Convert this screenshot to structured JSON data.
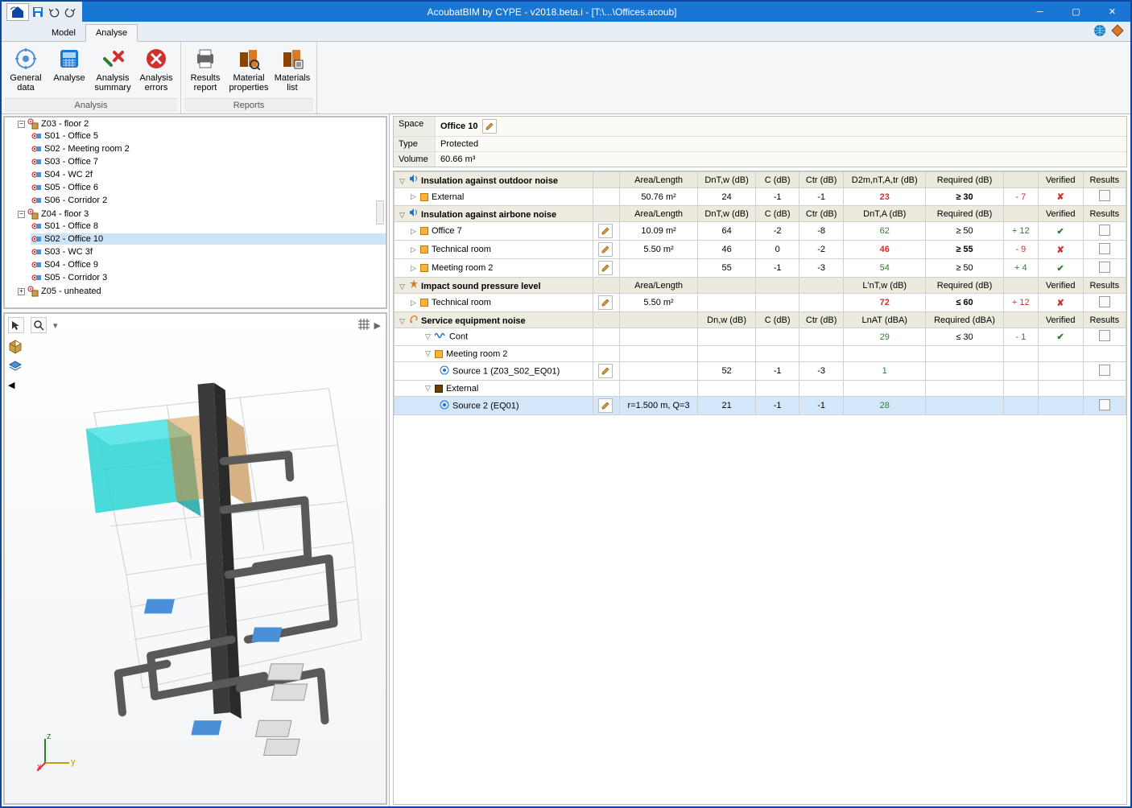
{
  "title": "AcoubatBIM by CYPE - v2018.beta.i - [T:\\...\\Offices.acoub]",
  "tabs": {
    "model": "Model",
    "analyse": "Analyse"
  },
  "ribbon": {
    "groups": [
      {
        "label": "Analysis",
        "items": [
          {
            "id": "general-data",
            "label": "General\ndata"
          },
          {
            "id": "analyse",
            "label": "Analyse"
          },
          {
            "id": "analysis-summary",
            "label": "Analysis\nsummary"
          },
          {
            "id": "analysis-errors",
            "label": "Analysis\nerrors"
          }
        ]
      },
      {
        "label": "Reports",
        "items": [
          {
            "id": "results-report",
            "label": "Results\nreport"
          },
          {
            "id": "material-properties",
            "label": "Material\nproperties"
          },
          {
            "id": "materials-list",
            "label": "Materials\nlist"
          }
        ]
      }
    ]
  },
  "tree": {
    "nodes": [
      {
        "label": "Z03 - floor 2",
        "type": "zone",
        "expanded": true,
        "children": [
          {
            "label": "S01 - Office 5"
          },
          {
            "label": "S02 - Meeting room 2"
          },
          {
            "label": "S03 - Office 7"
          },
          {
            "label": "S04 - WC 2f"
          },
          {
            "label": "S05 - Office 6"
          },
          {
            "label": "S06 - Corridor 2"
          }
        ]
      },
      {
        "label": "Z04 - floor 3",
        "type": "zone",
        "expanded": true,
        "children": [
          {
            "label": "S01 - Office 8"
          },
          {
            "label": "S02 - Office 10",
            "selected": true
          },
          {
            "label": "S03 - WC 3f"
          },
          {
            "label": "S04 - Office 9"
          },
          {
            "label": "S05 - Corridor 3"
          }
        ]
      },
      {
        "label": "Z05 - unheated",
        "type": "zone",
        "expanded": false
      }
    ]
  },
  "info": {
    "space_label": "Space",
    "space_value": "Office 10",
    "type_label": "Type",
    "type_value": "Protected",
    "volume_label": "Volume",
    "volume_value": "60.66  m³"
  },
  "table": {
    "sections": [
      {
        "title": "Insulation against outdoor noise",
        "headers": [
          "Area/Length",
          "DnT,w (dB)",
          "C (dB)",
          "Ctr (dB)",
          "D2m,nT,A,tr (dB)",
          "Required (dB)",
          "",
          "Verified",
          "Results"
        ],
        "rows": [
          {
            "label": "External",
            "area": "50.76 m²",
            "dntw": "24",
            "c": "-1",
            "ctr": "-1",
            "big": "23",
            "bigclass": "red",
            "req": "≥ 30",
            "reqclass": "bold",
            "diff": "- 7",
            "diffclass": "red",
            "verified": "cross",
            "results": true
          }
        ]
      },
      {
        "title": "Insulation against airbone noise",
        "headers": [
          "Area/Length",
          "DnT,w (dB)",
          "C (dB)",
          "Ctr (dB)",
          "DnT,A (dB)",
          "Required (dB)",
          "",
          "Verified",
          "Results"
        ],
        "rows": [
          {
            "label": "Office 7",
            "edit": true,
            "area": "10.09 m²",
            "dntw": "64",
            "c": "-2",
            "ctr": "-8",
            "big": "62",
            "bigclass": "green",
            "req": "≥ 50",
            "diff": "+ 12",
            "diffclass": "green",
            "verified": "check",
            "results": true
          },
          {
            "label": "Technical room",
            "edit": true,
            "area": "5.50 m²",
            "dntw": "46",
            "c": "0",
            "ctr": "-2",
            "big": "46",
            "bigclass": "red",
            "req": "≥ 55",
            "reqclass": "bold",
            "diff": "- 9",
            "diffclass": "red",
            "verified": "cross",
            "results": true
          },
          {
            "label": "Meeting room 2",
            "edit": true,
            "area": "",
            "dntw": "55",
            "c": "-1",
            "ctr": "-3",
            "big": "54",
            "bigclass": "green",
            "req": "≥ 50",
            "diff": "+ 4",
            "diffclass": "green",
            "verified": "check",
            "results": true
          }
        ]
      },
      {
        "title": "Impact sound pressure level",
        "headers": [
          "Area/Length",
          "",
          "",
          "",
          "L'nT,w (dB)",
          "Required (dB)",
          "",
          "Verified",
          "Results"
        ],
        "rows": [
          {
            "label": "Technical room",
            "edit": true,
            "area": "5.50 m²",
            "dntw": "",
            "c": "",
            "ctr": "",
            "big": "72",
            "bigclass": "red",
            "req": "≤ 60",
            "reqclass": "bold",
            "diff": "+ 12",
            "diffclass": "red",
            "verified": "cross",
            "results": true
          }
        ]
      },
      {
        "title": "Service equipment noise",
        "headers": [
          "",
          "Dn,w (dB)",
          "C (dB)",
          "Ctr (dB)",
          "LnAT (dBA)",
          "Required (dBA)",
          "",
          "Verified",
          "Results"
        ],
        "rows": [
          {
            "label": "Cont",
            "indent": 1,
            "icontype": "wave",
            "big": "29",
            "bigclass": "green",
            "req": "≤ 30",
            "diff": "- 1",
            "diffclass": "green",
            "verified": "check",
            "results": true
          },
          {
            "label": "Meeting room 2",
            "indent": 1,
            "icontype": "orange"
          },
          {
            "label": "Source 1 (Z03_S02_EQ01)",
            "indent": 2,
            "icontype": "src",
            "edit": true,
            "dntw": "52",
            "c": "-1",
            "ctr": "-3",
            "big": "1",
            "bigclass": "green",
            "results": true
          },
          {
            "label": "External",
            "indent": 1,
            "icontype": "dark"
          },
          {
            "label": "Source 2 (EQ01)",
            "indent": 2,
            "icontype": "src",
            "edit": true,
            "area": "r=1.500 m, Q=3",
            "dntw": "21",
            "c": "-1",
            "ctr": "-1",
            "big": "28",
            "bigclass": "green",
            "results": true,
            "selected": true
          }
        ]
      }
    ]
  }
}
